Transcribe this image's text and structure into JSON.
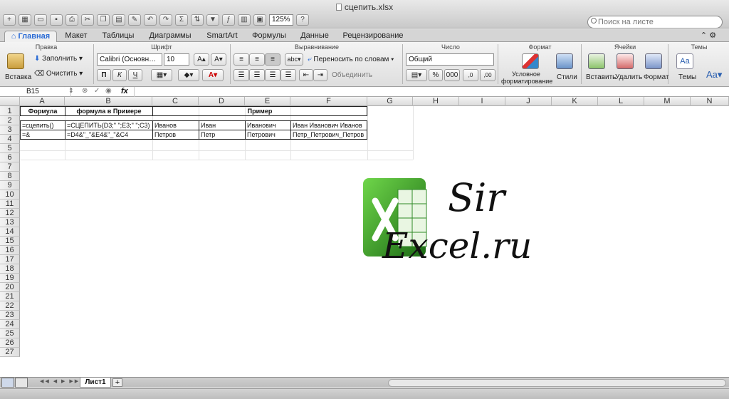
{
  "window": {
    "title": "сцепить.xlsx"
  },
  "toolbar": {
    "zoom": "125%",
    "search_placeholder": "Поиск на листе"
  },
  "tabs": [
    "Главная",
    "Макет",
    "Таблицы",
    "Диаграммы",
    "SmartArt",
    "Формулы",
    "Данные",
    "Рецензирование"
  ],
  "ribbon": {
    "groups": {
      "edit": "Правка",
      "font": "Шрифт",
      "align": "Выравнивание",
      "number": "Число",
      "format": "Формат",
      "cells": "Ячейки",
      "themes": "Темы"
    },
    "paste": "Вставка",
    "fill": "Заполнить",
    "clear": "Очистить",
    "font_name": "Calibri (Основн…",
    "font_size": "10",
    "bold": "П",
    "italic": "К",
    "underline": "Ч",
    "wrap": "Переносить по словам",
    "merge": "Объединить",
    "number_format": "Общий",
    "conditional": "Условное форматирование",
    "styles": "Стили",
    "insert": "Вставить",
    "delete": "Удалить",
    "format": "Формат",
    "themes": "Темы"
  },
  "formula_bar": {
    "cell_ref": "B15",
    "fx": "fx",
    "formula": ""
  },
  "columns": [
    "A",
    "B",
    "C",
    "D",
    "E",
    "F",
    "G",
    "H",
    "I",
    "J",
    "K",
    "L",
    "M",
    "N"
  ],
  "rows": [
    "1",
    "2",
    "3",
    "4",
    "5",
    "6",
    "7",
    "8",
    "9",
    "10",
    "11",
    "12",
    "13",
    "14",
    "15",
    "16",
    "17",
    "18",
    "19",
    "20",
    "21",
    "22",
    "23",
    "24",
    "25",
    "26",
    "27"
  ],
  "cells": {
    "a1": "Формула",
    "b1": "формула в Примере",
    "c1": "Пример",
    "a3": "=сцепить()",
    "b3": "=СЦЕПИТЬ(D3;\" \";E3;\" \";C3)",
    "c3": "Иванов",
    "d3": "Иван",
    "e3": "Иванович",
    "f3": "Иван Иванович Иванов",
    "a4": "=&",
    "b4": "=D4&\"_\"&E4&\"_\"&C4",
    "c4": "Петров",
    "d4": "Петр",
    "e4": "Петрович",
    "f4": "Петр_Петрович_Петров"
  },
  "logo": {
    "line1": "Sir",
    "line2": "Excel.ru"
  },
  "sheets": {
    "active": "Лист1",
    "add": "+"
  }
}
